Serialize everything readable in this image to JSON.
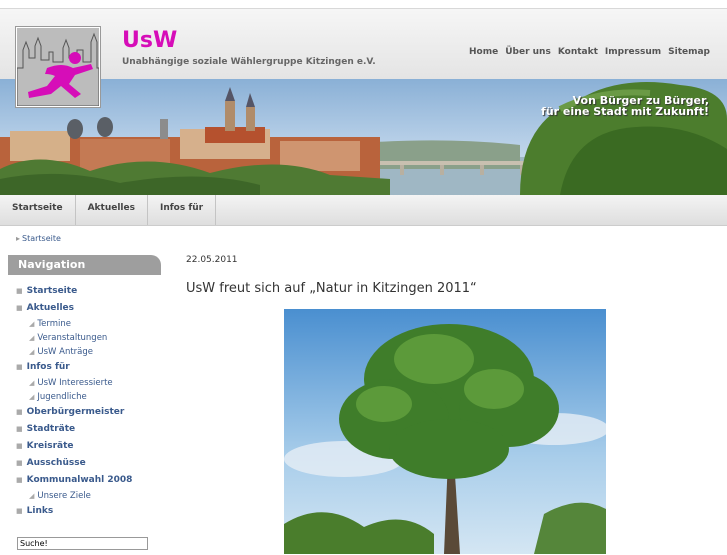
{
  "site": {
    "name": "UsW",
    "subtitle": "Unabhängige soziale Wählergruppe Kitzingen e.V."
  },
  "topnav": [
    "Home",
    "Über uns",
    "Kontakt",
    "Impressum",
    "Sitemap"
  ],
  "banner": {
    "slogan_line1": "Von Bürger zu Bürger,",
    "slogan_line2": "für eine Stadt mit Zukunft!"
  },
  "mainnav": [
    "Startseite",
    "Aktuelles",
    "Infos für"
  ],
  "breadcrumb": "Startseite",
  "sidebar": {
    "heading": "Navigation",
    "items": [
      {
        "label": "Startseite",
        "level": 1
      },
      {
        "label": "Aktuelles",
        "level": 1
      },
      {
        "label": "Termine",
        "level": 2
      },
      {
        "label": "Veranstaltungen",
        "level": 2
      },
      {
        "label": "UsW Anträge",
        "level": 2
      },
      {
        "label": "Infos für",
        "level": 1
      },
      {
        "label": "UsW Interessierte",
        "level": 2
      },
      {
        "label": "Jugendliche",
        "level": 2
      },
      {
        "label": "Oberbürgermeister",
        "level": 1
      },
      {
        "label": "Stadträte",
        "level": 1
      },
      {
        "label": "Kreisräte",
        "level": 1
      },
      {
        "label": "Ausschüsse",
        "level": 1
      },
      {
        "label": "Kommunalwahl 2008",
        "level": 1
      },
      {
        "label": "Unsere Ziele",
        "level": 2
      },
      {
        "label": "Links",
        "level": 1
      }
    ],
    "search_value": "Suche!"
  },
  "article": {
    "date": "22.05.2011",
    "title": "UsW freut sich auf „Natur in Kitzingen 2011“"
  },
  "colors": {
    "brand": "#d60db8",
    "link": "#3a5a8c",
    "sidebar_heading": "#9e9e9e"
  }
}
